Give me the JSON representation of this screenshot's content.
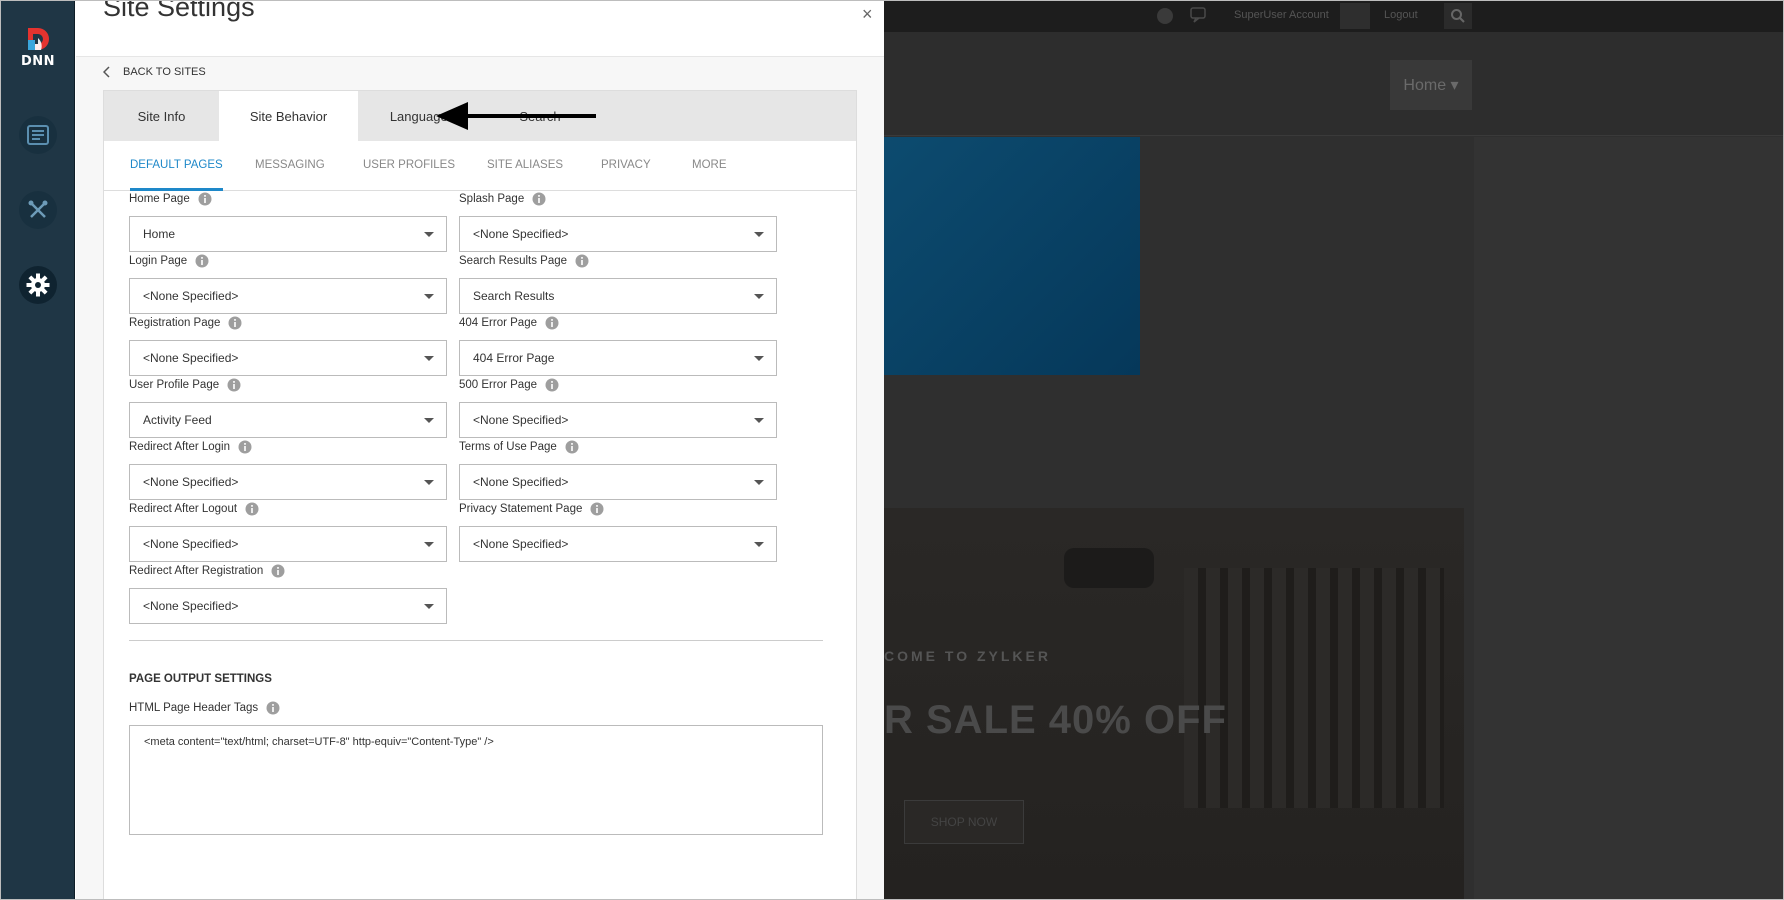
{
  "sidebar": {
    "logo_text": "DNN",
    "items": [
      {
        "name": "content",
        "icon": "content-icon"
      },
      {
        "name": "tools",
        "icon": "tools-icon"
      },
      {
        "name": "settings",
        "icon": "gear-icon"
      }
    ]
  },
  "modal": {
    "title": "Site Settings",
    "close_label": "×",
    "back_label": "BACK TO SITES",
    "main_tabs": [
      {
        "label": "Site Info"
      },
      {
        "label": "Site Behavior",
        "active": true
      },
      {
        "label": "Languages"
      },
      {
        "label": "Search"
      }
    ],
    "sub_tabs": [
      {
        "label": "DEFAULT PAGES",
        "active": true
      },
      {
        "label": "MESSAGING"
      },
      {
        "label": "USER PROFILES"
      },
      {
        "label": "SITE ALIASES"
      },
      {
        "label": "PRIVACY"
      },
      {
        "label": "MORE"
      }
    ],
    "fields": {
      "home_page": {
        "label": "Home Page",
        "value": "Home"
      },
      "splash_page": {
        "label": "Splash Page",
        "value": "<None Specified>"
      },
      "login_page": {
        "label": "Login Page",
        "value": "<None Specified>"
      },
      "search_results_page": {
        "label": "Search Results Page",
        "value": "Search Results"
      },
      "registration_page": {
        "label": "Registration Page",
        "value": "<None Specified>"
      },
      "error_404_page": {
        "label": "404 Error Page",
        "value": "404 Error Page"
      },
      "user_profile_page": {
        "label": "User Profile Page",
        "value": "Activity Feed"
      },
      "error_500_page": {
        "label": "500 Error Page",
        "value": "<None Specified>"
      },
      "redirect_after_login": {
        "label": "Redirect After Login",
        "value": "<None Specified>"
      },
      "terms_of_use_page": {
        "label": "Terms of Use Page",
        "value": "<None Specified>"
      },
      "redirect_after_logout": {
        "label": "Redirect After Logout",
        "value": "<None Specified>"
      },
      "privacy_statement_page": {
        "label": "Privacy Statement Page",
        "value": "<None Specified>"
      },
      "redirect_after_registration": {
        "label": "Redirect After Registration",
        "value": "<None Specified>"
      }
    },
    "page_output": {
      "section_title": "PAGE OUTPUT SETTINGS",
      "header_tags_label": "HTML Page Header Tags",
      "header_tags_value": "<meta content=\"text/html; charset=UTF-8\" http-equiv=\"Content-Type\" />"
    }
  },
  "background_site": {
    "account_label": "SuperUser Account",
    "logout_label": "Logout",
    "nav_home": "Home ▾",
    "hero_welcome": "COME TO ZYLKER",
    "hero_sale": "R SALE 40% OFF",
    "hero_button": "SHOP NOW"
  },
  "colors": {
    "sidebar_bg": "#1f3645",
    "accent": "#1e88c9",
    "tab_bar_bg": "#e6e6e6"
  }
}
